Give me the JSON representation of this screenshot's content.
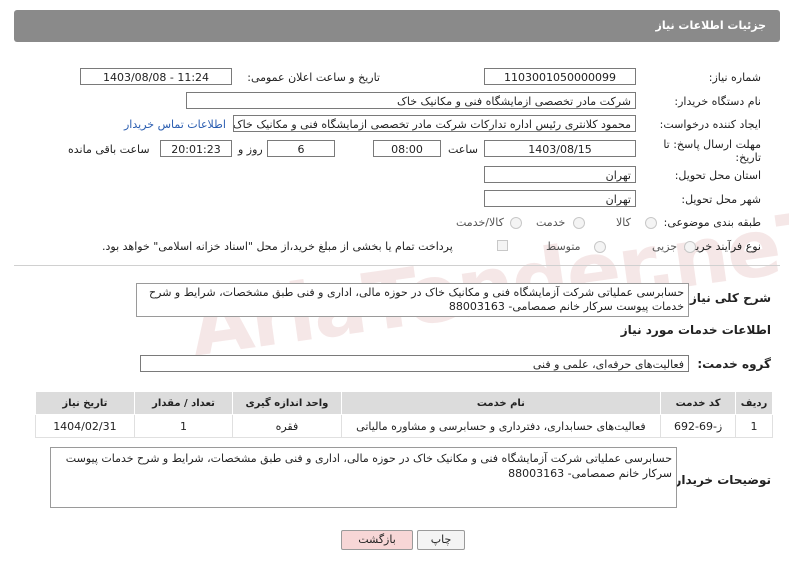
{
  "header": {
    "title": "جزئیات اطلاعات نیاز"
  },
  "form": {
    "need_number_label": "شماره نیاز:",
    "need_number": "1103001050000099",
    "announce_label": "تاریخ و ساعت اعلان عمومی:",
    "announce_value": "1403/08/08 - 11:24",
    "buyer_org_label": "نام دستگاه خریدار:",
    "buyer_org": "شرکت مادر تخصصی ازمایشگاه فنی و مکانیک خاک",
    "creator_label": "ایجاد کننده درخواست:",
    "creator": "محمود کلانتری رئیس اداره تدارکات شرکت مادر تخصصی ازمایشگاه فنی و مکانیک خاک",
    "contact_link": "اطلاعات تماس خریدار",
    "deadline_label": "مهلت ارسال پاسخ: تا تاریخ:",
    "deadline_date": "1403/08/15",
    "time_label": "ساعت",
    "deadline_time": "08:00",
    "days_value": "6",
    "days_label": "روز و",
    "remaining_time": "20:01:23",
    "remaining_label": "ساعت باقی مانده",
    "province_label": "استان محل تحویل:",
    "province": "تهران",
    "city_label": "شهر محل تحویل:",
    "city": "تهران",
    "category_label": "طبقه بندی موضوعی:",
    "category_options": [
      "کالا",
      "خدمت",
      "کالا/خدمت"
    ],
    "process_label": "نوع فرآیند خرید :",
    "process_options": [
      "جزیی",
      "متوسط"
    ],
    "payment_note": "پرداخت تمام یا بخشی از مبلغ خرید،از محل \"اسناد خزانه اسلامی\" خواهد بود."
  },
  "summary": {
    "label": "شرح کلی نیاز:",
    "text": "حسابرسی عملیاتی شرکت آزمایشگاه فنی و مکانیک خاک در حوزه مالی، اداری و فنی طبق مشخصات، شرایط و شرح خدمات پیوست سرکار خانم صمصامی- 88003163"
  },
  "services": {
    "section_title": "اطلاعات خدمات مورد نیاز",
    "group_label": "گروه خدمت:",
    "group_value": "فعالیت‌های حرفه‌ای، علمی و فنی",
    "columns": [
      "ردیف",
      "کد خدمت",
      "نام خدمت",
      "واحد اندازه گیری",
      "تعداد / مقدار",
      "تاریخ نیاز"
    ],
    "rows": [
      [
        "1",
        "ز-69-692",
        "فعالیت‌های حسابداری، دفترداری و حسابرسی و مشاوره مالیاتی",
        "فقره",
        "1",
        "1404/02/31"
      ]
    ]
  },
  "buyer_notes": {
    "label": "توضیحات خریدار:",
    "text": "حسابرسی عملیاتی شرکت آزمایشگاه فنی و مکانیک خاک در حوزه مالی، اداری و فنی طبق مشخصات، شرایط و شرح خدمات پیوست سرکار خانم صمصامی- 88003163"
  },
  "buttons": {
    "print": "چاپ",
    "back": "بازگشت"
  },
  "colors": {
    "titlebar": "#8a8a8a",
    "back_button_bg": "#f7d6d6",
    "link": "#2a5db0"
  }
}
